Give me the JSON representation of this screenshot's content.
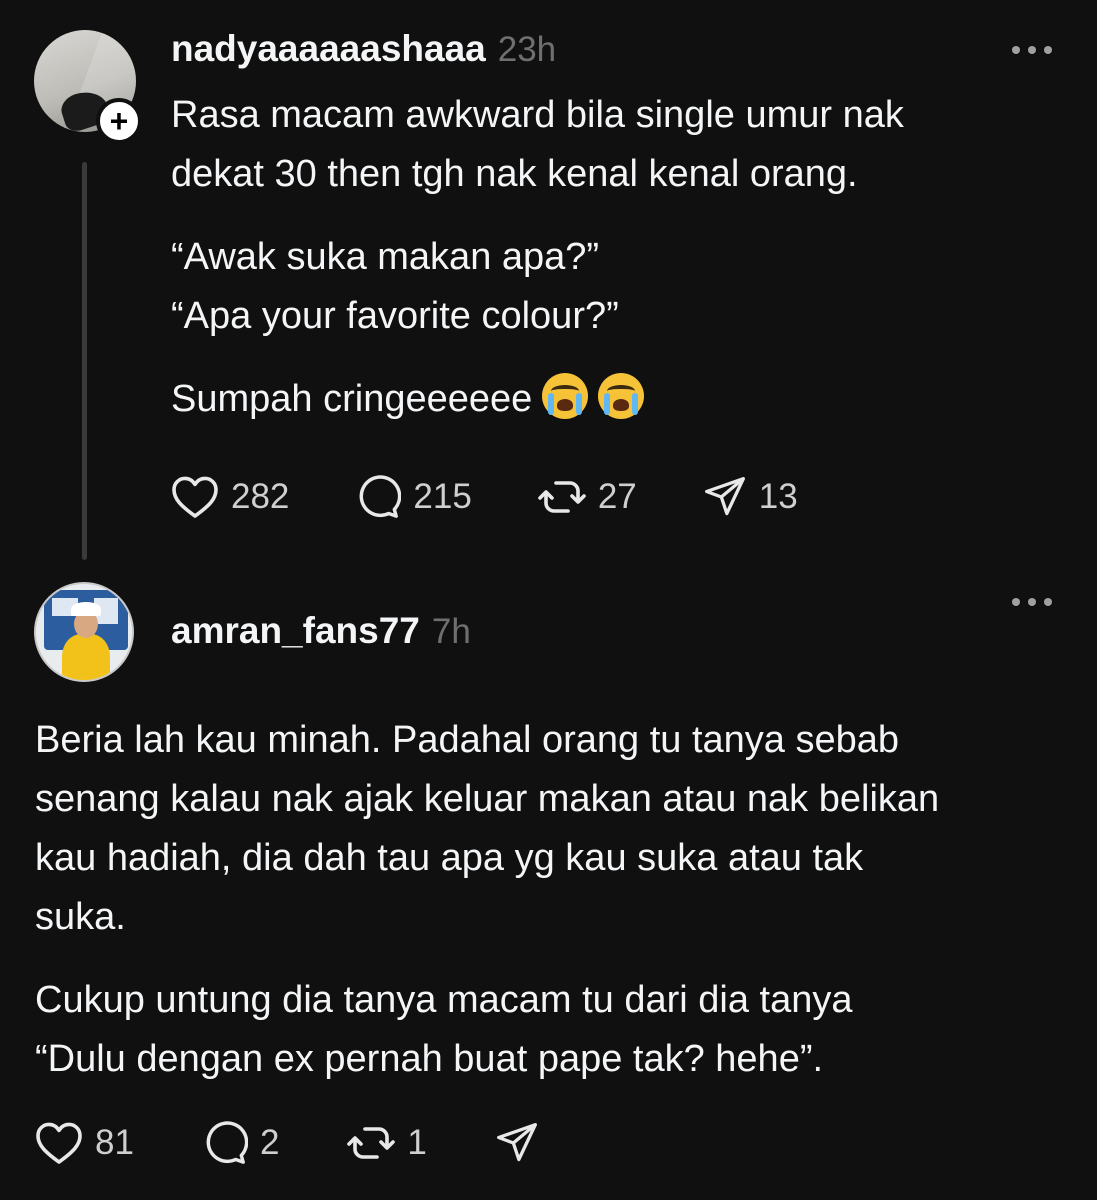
{
  "posts": [
    {
      "username": "nadyaaaaaashaaa",
      "time": "23h",
      "body": {
        "line1": "Rasa macam awkward bila single umur nak",
        "line2": "dekat 30 then tgh nak kenal kenal orang.",
        "line3": "“Awak suka makan apa?”",
        "line4": "“Apa your favorite colour?”",
        "line5": "Sumpah cringeeeeee"
      },
      "emoji": [
        "loudly-crying-face",
        "loudly-crying-face"
      ],
      "stats": {
        "likes": "282",
        "comments": "215",
        "reposts": "27",
        "shares": "13"
      }
    },
    {
      "username": "amran_fans77",
      "time": "7h",
      "body": {
        "line1": "Beria lah kau minah. Padahal orang tu tanya sebab",
        "line2": "senang kalau nak ajak keluar makan atau nak belikan",
        "line3": "kau hadiah, dia dah tau apa yg kau suka atau tak",
        "line4": "suka.",
        "line5": "Cukup untung dia tanya macam tu dari dia tanya",
        "line6": "“Dulu dengan ex pernah buat pape tak? hehe”."
      },
      "stats": {
        "likes": "81",
        "comments": "2",
        "reposts": "1"
      }
    }
  ],
  "colors": {
    "background": "#101010",
    "text": "#f3f5f7",
    "muted": "#6f6f6f",
    "thread_line": "#3a3a3a"
  },
  "icons": [
    "heart-icon",
    "comment-icon",
    "repost-icon",
    "share-icon",
    "more-icon",
    "plus-icon"
  ]
}
